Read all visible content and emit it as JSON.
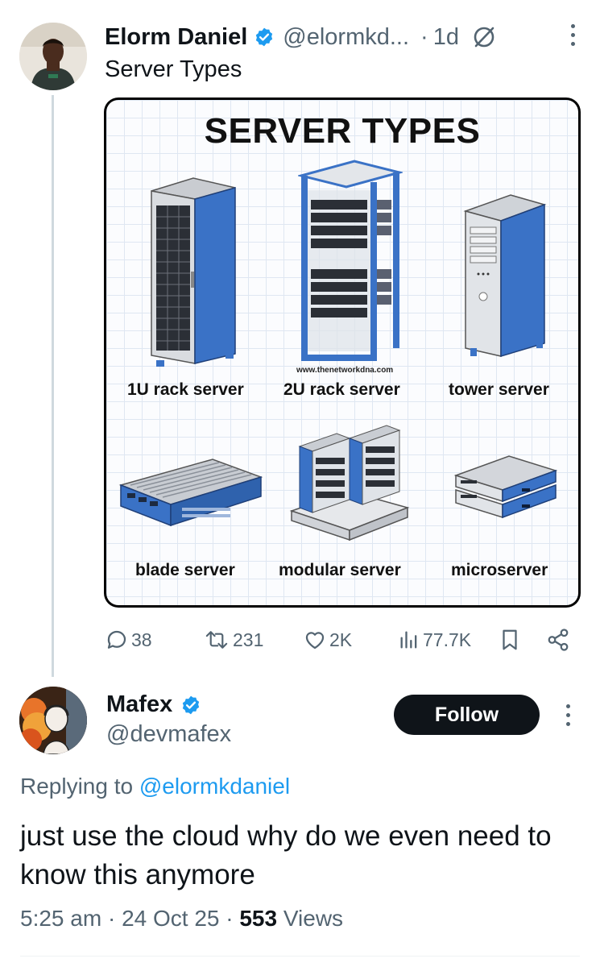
{
  "parent_tweet": {
    "author_name": "Elorm Daniel",
    "author_handle": "@elormkd...",
    "separator": "·",
    "time_ago": "1d",
    "text": "Server Types",
    "image": {
      "title": "SERVER TYPES",
      "watermark": "www.thenetworkdna.com",
      "labels": [
        "1U rack server",
        "2U rack server",
        "tower server",
        "blade server",
        "modular server",
        "microserver"
      ]
    },
    "stats": {
      "replies": "38",
      "reposts": "231",
      "likes": "2K",
      "views": "77.7K"
    },
    "icons": [
      "verified-badge-icon",
      "grok-icon",
      "more-icon",
      "reply-icon",
      "repost-icon",
      "like-icon",
      "views-icon",
      "bookmark-icon",
      "share-icon"
    ]
  },
  "reply": {
    "author_name": "Mafex",
    "author_handle": "@devmafex",
    "follow_label": "Follow",
    "replying_prefix": "Replying to",
    "replying_handle": "@elormkdaniel",
    "text": "just use the cloud why do we even need to know this anymore",
    "time": "5:25 am",
    "date": "24 Oct 25",
    "views_count": "553",
    "views_label": "Views",
    "separator": "·"
  },
  "colors": {
    "text_primary": "#0f1419",
    "text_secondary": "#536471",
    "link": "#1d9bf0",
    "verified": "#1d9bf0",
    "follow_bg": "#0f1419",
    "server_blue": "#3a72c6"
  }
}
